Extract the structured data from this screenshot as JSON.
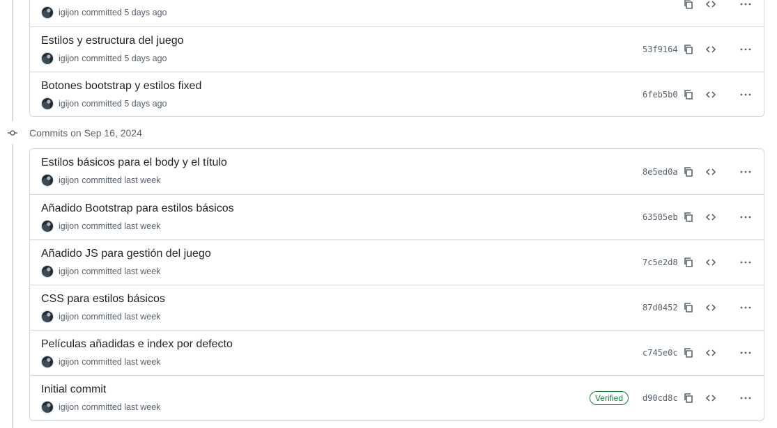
{
  "groups": [
    {
      "header": "",
      "commits": [
        {
          "title": "",
          "author": "igijon",
          "time": "committed 5 days ago",
          "sha": "",
          "verified": false
        },
        {
          "title": "Estilos y estructura del juego",
          "author": "igijon",
          "time": "committed 5 days ago",
          "sha": "53f9164",
          "verified": false
        },
        {
          "title": "Botones bootstrap y estilos fixed",
          "author": "igijon",
          "time": "committed 5 days ago",
          "sha": "6feb5b0",
          "verified": false
        }
      ]
    },
    {
      "header": "Commits on Sep 16, 2024",
      "commits": [
        {
          "title": "Estilos básicos para el body y el título",
          "author": "igijon",
          "time": "committed last week",
          "sha": "8e5ed0a",
          "verified": false
        },
        {
          "title": "Añadido Bootstrap para estilos básicos",
          "author": "igijon",
          "time": "committed last week",
          "sha": "63505eb",
          "verified": false
        },
        {
          "title": "Añadido JS para gestión del juego",
          "author": "igijon",
          "time": "committed last week",
          "sha": "7c5e2d8",
          "verified": false
        },
        {
          "title": "CSS para estilos básicos",
          "author": "igijon",
          "time": "committed last week",
          "sha": "87d0452",
          "verified": false
        },
        {
          "title": "Películas añadidas e index por defecto",
          "author": "igijon",
          "time": "committed last week",
          "sha": "c745e0c",
          "verified": false
        },
        {
          "title": "Initial commit",
          "author": "igijon",
          "time": "committed last week",
          "sha": "d90cd8c",
          "verified": true
        }
      ]
    }
  ],
  "labels": {
    "verified": "Verified"
  },
  "colors": {
    "border": "#d1d9e0",
    "muted": "#59636e",
    "verified": "#1a7f37"
  },
  "icons": {
    "copy": "copy-icon",
    "browse": "code-icon",
    "more": "kebab-horizontal-icon",
    "commit": "git-commit-icon"
  }
}
